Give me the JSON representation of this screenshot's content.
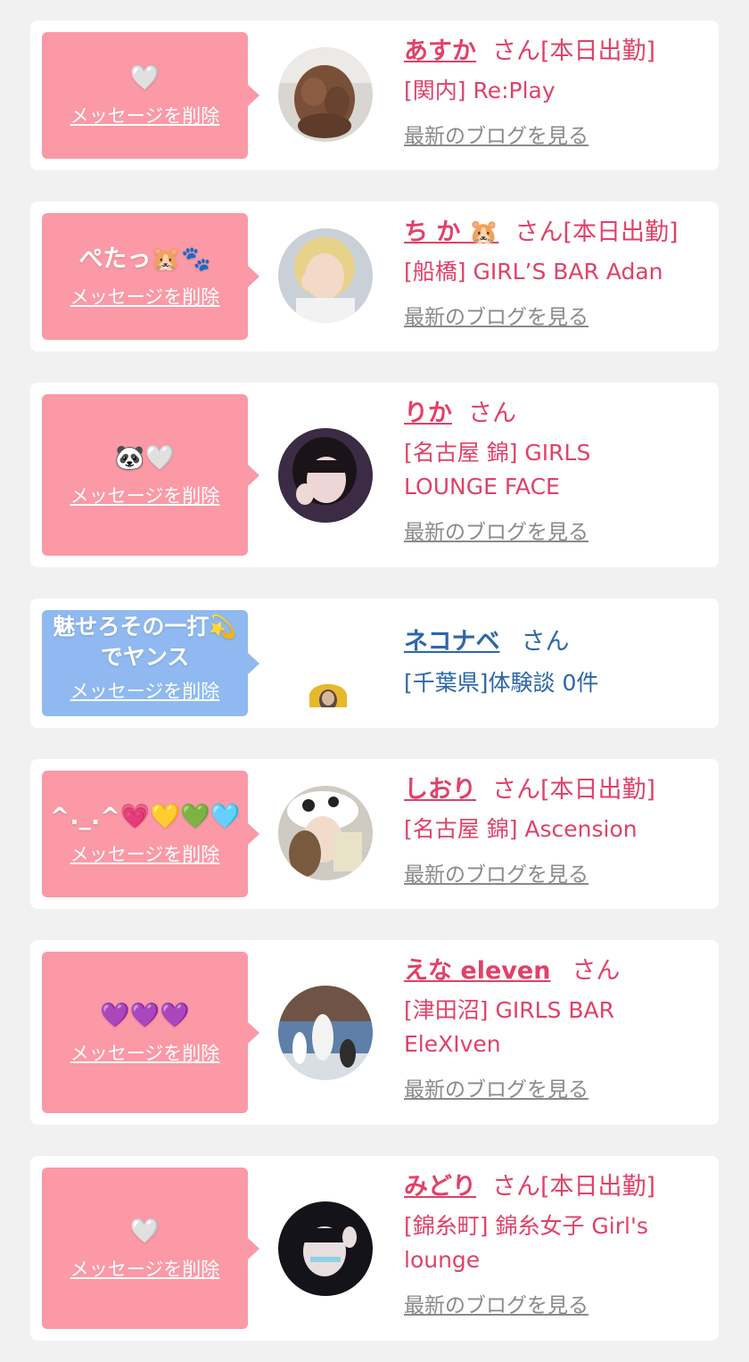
{
  "cards": [
    {
      "message": "🤍",
      "delete_label": "メッセージを削除",
      "name": "あすか",
      "san": "さん",
      "status": "[本日出勤]",
      "shop": "[関内] Re:Play",
      "blog": "最新のブログを見る"
    },
    {
      "message": "ぺたっ🐹🐾",
      "delete_label": "メッセージを削除",
      "name": "ち か 🐹",
      "san": "さん",
      "status": "[本日出勤]",
      "shop": "[船橋] GIRL’S BAR Adan",
      "blog": "最新のブログを見る"
    },
    {
      "message": "🐼🤍",
      "delete_label": "メッセージを削除",
      "name": "りか",
      "san": "さん",
      "status": "",
      "shop": "[名古屋 錦] GIRLS LOUNGE FACE",
      "blog": "最新のブログを見る"
    },
    {
      "message": "魅せろその一打💫でヤンス",
      "delete_label": "メッセージを削除",
      "name": "ネコナベ",
      "san": "さん",
      "status": "",
      "shop": "[千葉県]体験談 0件",
      "blog": ""
    },
    {
      "message": "^._.^💗💛💚🩵",
      "delete_label": "メッセージを削除",
      "name": "しおり",
      "san": "さん",
      "status": "[本日出勤]",
      "shop": "[名古屋 錦] Ascension",
      "blog": "最新のブログを見る"
    },
    {
      "message": "💜💜💜",
      "delete_label": "メッセージを削除",
      "name": "えな eleven",
      "san": "さん",
      "status": "",
      "shop": "[津田沼] GIRLS BAR EleXIven",
      "blog": "最新のブログを見る"
    },
    {
      "message": "🤍",
      "delete_label": "メッセージを削除",
      "name": "みどり",
      "san": "さん",
      "status": "[本日出勤]",
      "shop": "[錦糸町] 錦糸女子 Girl's lounge",
      "blog": "最新のブログを見る"
    }
  ],
  "colors": {
    "page_bg": "#f1f1f1",
    "card_bg": "#ffffff",
    "pink_bubble": "#fb99a6",
    "blue_bubble": "#8fb9f0",
    "pink_text": "#e14169",
    "blue_text": "#2d67a8",
    "blog_link": "#8a8a8a"
  }
}
